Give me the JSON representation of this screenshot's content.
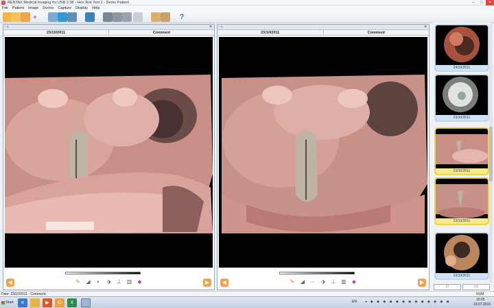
{
  "window": {
    "title": "RENTAX Medical Imaging for USB 2.38 - Hex Text Test 1 - Demo Patient",
    "controls": [
      "minimize",
      "maximize",
      "close"
    ]
  },
  "menu": [
    "File",
    "Patient",
    "Image",
    "Doctor",
    "Capture",
    "Display",
    "Help"
  ],
  "toolbar": {
    "icons": [
      "open-folder-icon",
      "folder-icon",
      "new-image-icon",
      "add-icon",
      "print-icon",
      "monitor-icon",
      "camera-icon",
      "user-icon",
      "film-icon",
      "printer-icon",
      "cursor-icon",
      "transfer-icon",
      "copy-icon",
      "help-icon"
    ],
    "help_glyph": "?"
  },
  "panes": {
    "left": {
      "date": "23/10/2011",
      "comment": "Comment",
      "close": "×",
      "pin": "⊣"
    },
    "right": {
      "date": "23/10/2011",
      "comment": "Comment",
      "close": "×",
      "pin": "⊣"
    }
  },
  "thumbnails": [
    {
      "date": "24/10/2011",
      "selected": false
    },
    {
      "date": "23/10/2011",
      "selected": false
    },
    {
      "date": "23/10/2011",
      "selected": true
    },
    {
      "date": "23/10/2011",
      "selected": true
    },
    {
      "date": "23/10/2011",
      "selected": false
    }
  ],
  "status": {
    "text": "Date: 23/10/2011 - Comment:",
    "num": "NUM"
  },
  "taskbar": {
    "start": "Start",
    "language": "EN",
    "time": "10:05",
    "date": "19.07.2016"
  },
  "colors": {
    "selected_border": "#f1d63b",
    "caption": "#cfe4f6",
    "accent_orange": "#f3a050"
  }
}
